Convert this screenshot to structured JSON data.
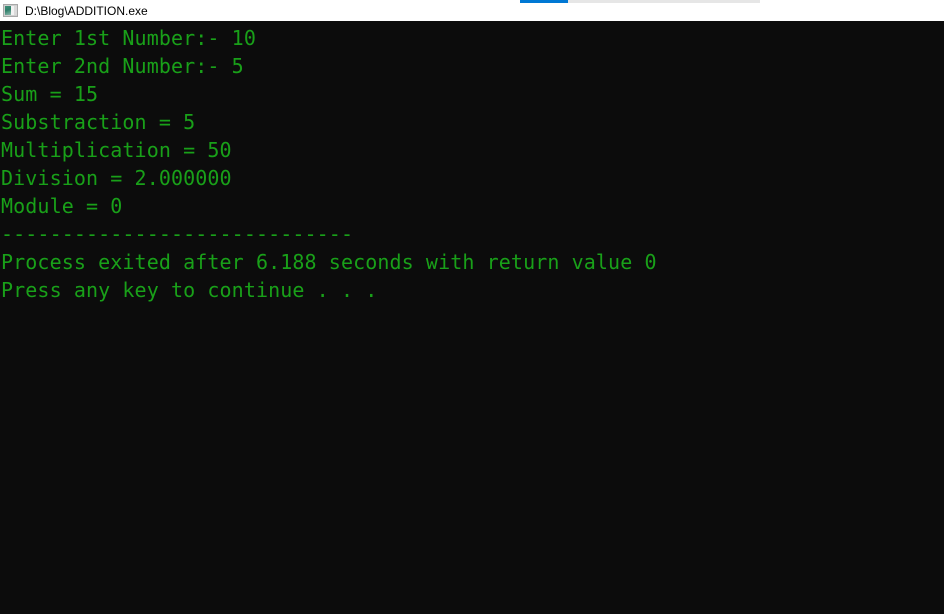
{
  "window": {
    "title": "D:\\Blog\\ADDITION.exe",
    "icon": "console-app-icon"
  },
  "top_strip": {
    "name": "loading-progress-strip",
    "fill_color": "#0078d4",
    "track_color": "#e6e6e6"
  },
  "console": {
    "background_color": "#0c0c0c",
    "text_color": "#19a019",
    "lines": [
      "Enter 1st Number:- 10",
      "Enter 2nd Number:- 5",
      "Sum = 15",
      "Substraction = 5",
      "Multiplication = 50",
      "Division = 2.000000",
      "Module = 0",
      "-----------------------------",
      "Process exited after 6.188 seconds with return value 0",
      "Press any key to continue . . ."
    ],
    "values": {
      "first_number": "10",
      "second_number": "5",
      "sum": "15",
      "substraction": "5",
      "multiplication": "50",
      "division": "2.000000",
      "module": "0",
      "exit_seconds": "6.188",
      "return_value": "0"
    }
  }
}
